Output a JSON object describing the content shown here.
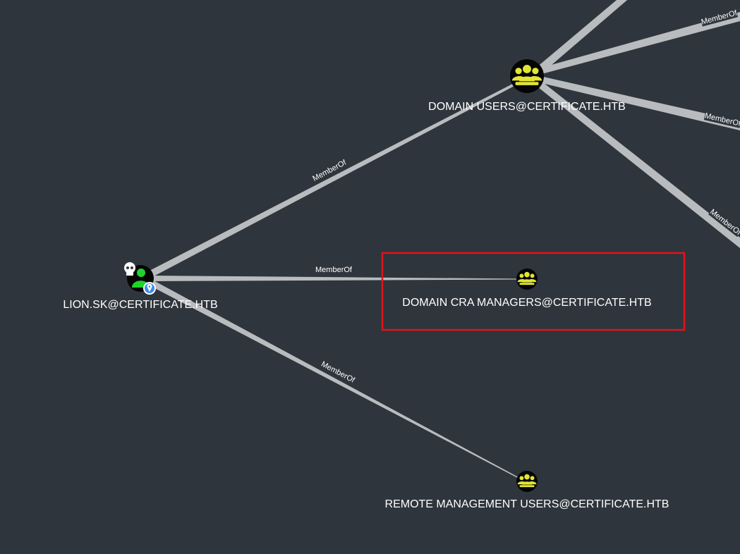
{
  "graph": {
    "nodes": {
      "lion": {
        "label": "LION.SK@CERTIFICATE.HTB",
        "type": "user"
      },
      "domain_users": {
        "label": "DOMAIN USERS@CERTIFICATE.HTB",
        "type": "group"
      },
      "cra_managers": {
        "label": "DOMAIN CRA MANAGERS@CERTIFICATE.HTB",
        "type": "group"
      },
      "remote_mgmt": {
        "label": "REMOTE MANAGEMENT USERS@CERTIFICATE.HTB",
        "type": "group"
      }
    },
    "edges": {
      "lion_domain_users": {
        "label": "MemberOf"
      },
      "lion_cra": {
        "label": "MemberOf"
      },
      "lion_remote": {
        "label": "MemberOf"
      },
      "du_out_1": {
        "label": "MemberOf"
      },
      "du_out_2": {
        "label": "MemberOf"
      },
      "du_out_3": {
        "label": "MemberOf"
      }
    }
  },
  "colors": {
    "background": "#2f353c",
    "edge": "#b9bcbf",
    "group_icon": "#e2e534",
    "user_icon": "#1ed42b",
    "highlight_box": "#e1131b",
    "owned_badge": "#ffffff",
    "location_badge": "#3d8ee8"
  },
  "icons": {
    "group": "group-users-icon",
    "user": "user-icon",
    "owned": "skull-icon",
    "location": "map-pin-icon"
  }
}
